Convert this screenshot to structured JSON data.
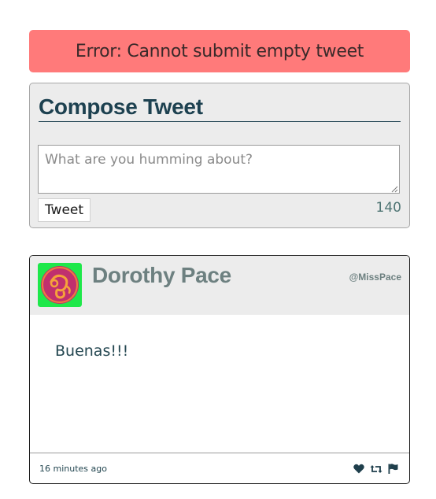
{
  "error": {
    "message": "Error: Cannot submit empty tweet",
    "color": "#ff7a7a"
  },
  "compose": {
    "title": "Compose Tweet",
    "placeholder": "What are you humming about?",
    "value": "",
    "button_label": "Tweet",
    "char_count": "140"
  },
  "tweets": [
    {
      "author_name": "Dorothy Pace",
      "handle": "@MissPace",
      "body": "Buenas!!!",
      "timestamp": "16 minutes ago",
      "avatar_icon": "avatar-icon",
      "actions": [
        "heart-icon",
        "retweet-icon",
        "flag-icon"
      ]
    }
  ],
  "colors": {
    "accent": "#1d4150",
    "muted": "#6d8080",
    "panel": "#ececec"
  }
}
